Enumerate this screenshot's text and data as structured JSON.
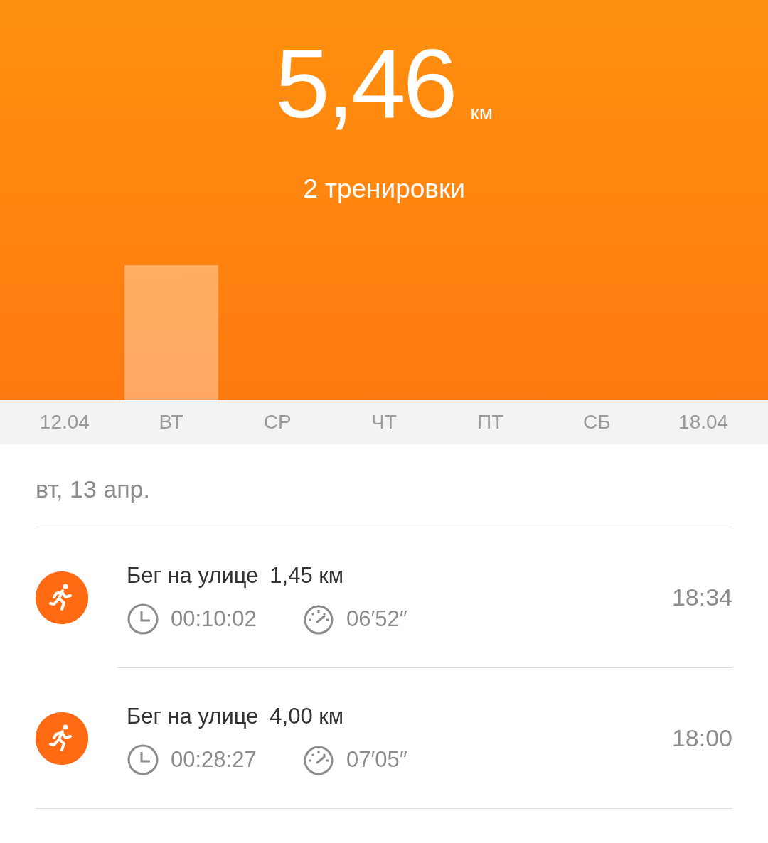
{
  "summary": {
    "distance": "5,46",
    "unit": "км",
    "workouts": "2 тренировки"
  },
  "days": [
    {
      "label": "12.04"
    },
    {
      "label": "ВТ"
    },
    {
      "label": "СР"
    },
    {
      "label": "ЧТ"
    },
    {
      "label": "ПТ"
    },
    {
      "label": "СБ"
    },
    {
      "label": "18.04"
    }
  ],
  "date_heading": "вт, 13 апр.",
  "workouts": [
    {
      "title": "Бег на улице",
      "distance": "1,45 км",
      "duration": "00:10:02",
      "pace": "06′52″",
      "time": "18:34"
    },
    {
      "title": "Бег на улице",
      "distance": "4,00 км",
      "duration": "00:28:27",
      "pace": "07′05″",
      "time": "18:00"
    }
  ]
}
